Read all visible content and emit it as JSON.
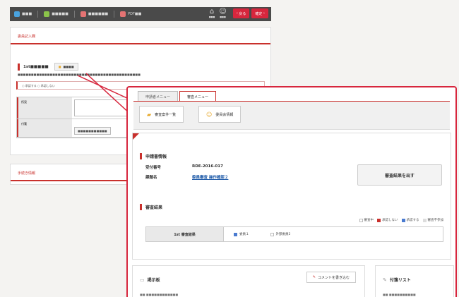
{
  "topbar": {
    "items": [
      {
        "label": "■■■",
        "icon": "home-icon",
        "color": "#4aa3df"
      },
      {
        "label": "■■■■■",
        "icon": "form-icon",
        "color": "#8bc34a"
      },
      {
        "label": "■■■■■■",
        "icon": "document-icon",
        "color": "#e57373"
      },
      {
        "label": "PDF■■",
        "icon": "pdf-icon",
        "color": "#e57373"
      }
    ],
    "icon_labels": [
      "■■■",
      "■■■"
    ],
    "back_label": "戻る",
    "confirm_label": "確定"
  },
  "back_window": {
    "header": "委員記入欄",
    "section_title": "1st■■■■■",
    "chip_label": "■■■■",
    "description": "■■■■■■■■■■■■■■■■■■■■■■■■■■■■■■■■■■■■■■■■■■■■■■",
    "radio_options": "○ 承認する ○ 承認しない",
    "table": [
      {
        "label": "所見",
        "value": ""
      },
      {
        "label": "付箋",
        "value": "■■■■■■■■■■■"
      }
    ],
    "section2_header": "手続き情報"
  },
  "front_window": {
    "tabs": [
      "申請者メニュー",
      "審査メニュー"
    ],
    "toolbar_buttons": [
      "審査案件一覧",
      "委員会情報"
    ],
    "applicant_section": "申請書情報",
    "fields": [
      {
        "key": "受付番号",
        "value": "RDE-2016-017"
      },
      {
        "key": "課題名",
        "value": "委員審査 操作確認２"
      }
    ],
    "submit_label": "審査結果を出す",
    "result_section": "審査結果",
    "legend": [
      {
        "label": "審査中",
        "color": "#ffffff"
      },
      {
        "label": "承認しない",
        "color": "#c9302c"
      },
      {
        "label": "承認する",
        "color": "#4a7bd0"
      },
      {
        "label": "審査不参加",
        "color": "#dddddd"
      }
    ],
    "result_row": {
      "head": "1st 審査結果",
      "cells": [
        {
          "label": "委員１",
          "color": "#4a7bd0"
        },
        {
          "label": "外部委員2",
          "color": "#ffffff"
        }
      ]
    },
    "board": {
      "title": "掲示板",
      "comment_label": "コメントを書き込む",
      "line": "■■ ■■■■■■■■■■■■"
    },
    "attach": {
      "title": "付箋リスト",
      "line": "■■ ■■■■■■■■■■"
    }
  }
}
